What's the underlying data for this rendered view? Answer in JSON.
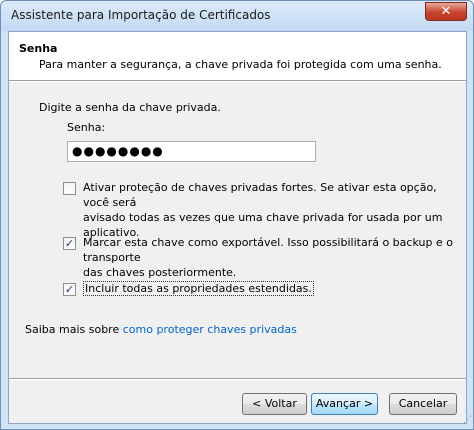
{
  "window": {
    "title": "Assistente para Importação de Certificados",
    "close_glyph": "✕"
  },
  "header": {
    "title": "Senha",
    "description": "Para manter a segurança, a chave privada foi protegida com uma senha."
  },
  "body": {
    "prompt": "Digite a senha da chave privada.",
    "password_label": "Senha:",
    "password_value": "●●●●●●●●",
    "options": [
      {
        "label_line1": "Ativar proteção de chaves privadas fortes. Se ativar esta opção, você será",
        "label_line2": "avisado todas as vezes que uma chave privada for usada por um aplicativo.",
        "checked": false
      },
      {
        "label_line1": "Marcar esta chave como exportável. Isso possibilitará o backup e o transporte",
        "label_line2": "das chaves posteriormente.",
        "checked": true
      },
      {
        "label_line1": "Incluir todas as propriedades estendidas.",
        "checked": true
      }
    ],
    "learn_more_prefix": "Saiba mais sobre ",
    "learn_more_link": "como proteger chaves privadas"
  },
  "footer": {
    "back_label": "< Voltar",
    "next_label": "Avançar >",
    "cancel_label": "Cancelar"
  },
  "icons": {
    "check_glyph": "✓",
    "grip_glyph": "⋰"
  },
  "colors": {
    "link": "#0066cc",
    "close_button": "#c8432c",
    "default_button_border": "#3c7fb1"
  }
}
